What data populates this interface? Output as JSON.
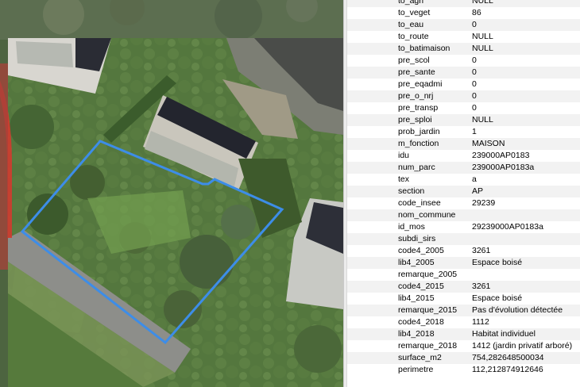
{
  "colors": {
    "parcel_outline": "#3d8de8",
    "selection_red": "#d23a2f"
  },
  "attributes": [
    {
      "name": "to_agri",
      "value": "NULL"
    },
    {
      "name": "to_veget",
      "value": "86"
    },
    {
      "name": "to_eau",
      "value": "0"
    },
    {
      "name": "to_route",
      "value": "NULL"
    },
    {
      "name": "to_batimaison",
      "value": "NULL"
    },
    {
      "name": "pre_scol",
      "value": "0"
    },
    {
      "name": "pre_sante",
      "value": "0"
    },
    {
      "name": "pre_eqadmi",
      "value": "0"
    },
    {
      "name": "pre_o_nrj",
      "value": "0"
    },
    {
      "name": "pre_transp",
      "value": "0"
    },
    {
      "name": "pre_sploi",
      "value": "NULL"
    },
    {
      "name": "prob_jardin",
      "value": "1"
    },
    {
      "name": "m_fonction",
      "value": "MAISON"
    },
    {
      "name": "idu",
      "value": "239000AP0183"
    },
    {
      "name": "num_parc",
      "value": "239000AP0183a"
    },
    {
      "name": "tex",
      "value": "a"
    },
    {
      "name": "section",
      "value": "AP"
    },
    {
      "name": "code_insee",
      "value": "29239"
    },
    {
      "name": "nom_commune",
      "value": ""
    },
    {
      "name": "id_mos",
      "value": "29239000AP0183a"
    },
    {
      "name": "subdi_sirs",
      "value": ""
    },
    {
      "name": "code4_2005",
      "value": "3261"
    },
    {
      "name": "lib4_2005",
      "value": "Espace boisé"
    },
    {
      "name": "remarque_2005",
      "value": ""
    },
    {
      "name": "code4_2015",
      "value": "3261"
    },
    {
      "name": "lib4_2015",
      "value": "Espace boisé"
    },
    {
      "name": "remarque_2015",
      "value": "Pas d'évolution détectée"
    },
    {
      "name": "code4_2018",
      "value": "1112"
    },
    {
      "name": "lib4_2018",
      "value": "Habitat individuel"
    },
    {
      "name": "remarque_2018",
      "value": "1412 (jardin privatif arboré)"
    },
    {
      "name": "surface_m2",
      "value": "754,282648500034"
    },
    {
      "name": "perimetre",
      "value": "112,212874912646"
    }
  ]
}
